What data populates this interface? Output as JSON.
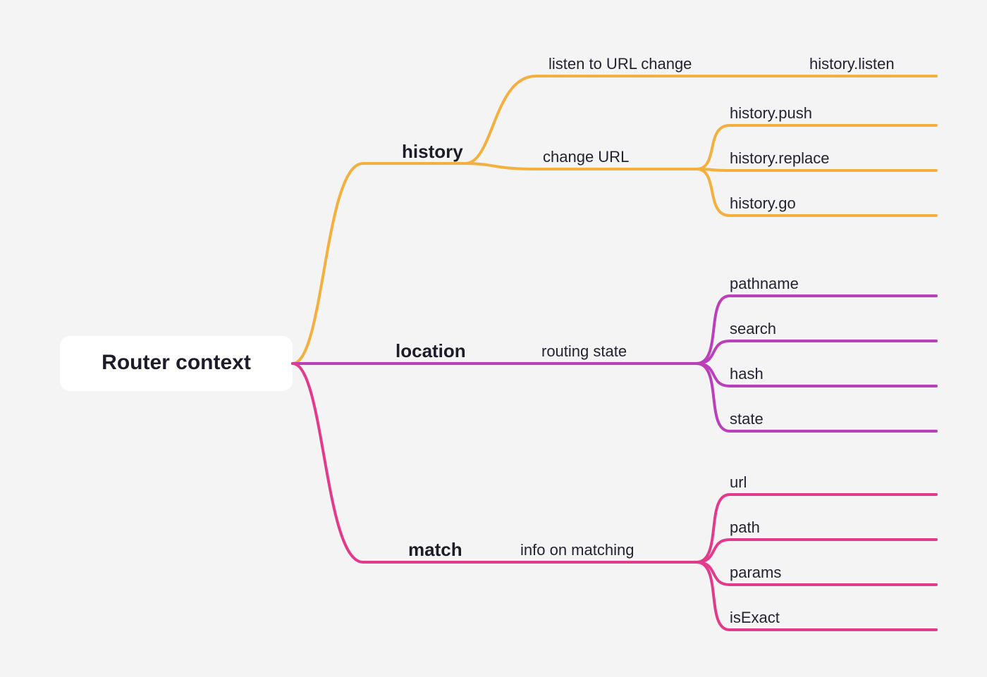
{
  "root": {
    "label": "Router context"
  },
  "colors": {
    "history": "#f4b03f",
    "location": "#bb3fbb",
    "match": "#e23b8b"
  },
  "branches": [
    {
      "key": "history",
      "label": "history",
      "subs": [
        {
          "label": "listen to URL change",
          "leaves": [
            "history.listen"
          ]
        },
        {
          "label": "change URL",
          "leaves": [
            "history.push",
            "history.replace",
            "history.go"
          ]
        }
      ]
    },
    {
      "key": "location",
      "label": "location",
      "subs": [
        {
          "label": "routing state",
          "leaves": [
            "pathname",
            "search",
            "hash",
            "state"
          ]
        }
      ]
    },
    {
      "key": "match",
      "label": "match",
      "subs": [
        {
          "label": "info on matching",
          "leaves": [
            "url",
            "path",
            "params",
            "isExact"
          ]
        }
      ]
    }
  ]
}
